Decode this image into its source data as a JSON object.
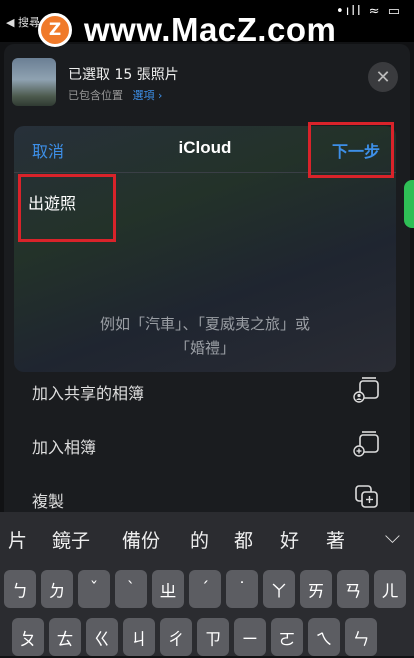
{
  "status": {
    "back_label": "◀ 搜尋",
    "right_icons": "•ıll ≈ ▭"
  },
  "watermark": {
    "logo_letter": "Z",
    "text": "www.MacZ.com"
  },
  "share": {
    "title": "已選取 15 張照片",
    "subtitle": "已包含位置",
    "options": "選項 ›"
  },
  "dialog": {
    "cancel": "取消",
    "title": "iCloud",
    "next": "下一步",
    "input_value": "出遊照",
    "hint_line1": "例如「汽車」、「夏威夷之旅」或",
    "hint_line2": "「婚禮」"
  },
  "actions": [
    {
      "label": "加入共享的相簿",
      "icon": "shared-album-icon"
    },
    {
      "label": "加入相簿",
      "icon": "add-album-icon"
    },
    {
      "label": "複製",
      "icon": "copy-icon"
    }
  ],
  "keyboard": {
    "candidates": [
      "片",
      "鏡子",
      "備份",
      "的",
      "都",
      "好",
      "著"
    ],
    "expand_icon": "chevron-down-icon",
    "row1": [
      "ㄅ",
      "ㄉ",
      "ˇ",
      "ˋ",
      "ㄓ",
      "ˊ",
      "˙",
      "ㄚ",
      "ㄞ",
      "ㄢ",
      "ㄦ"
    ],
    "row2": [
      "ㄆ",
      "ㄊ",
      "ㄍ",
      "ㄐ",
      "ㄔ",
      "ㄗ",
      "ㄧ",
      "ㄛ",
      "ㄟ",
      "ㄣ"
    ]
  },
  "colors": {
    "accent": "#3d8fe8",
    "highlight": "#d9232a",
    "watermark_logo": "#f07a2a"
  }
}
